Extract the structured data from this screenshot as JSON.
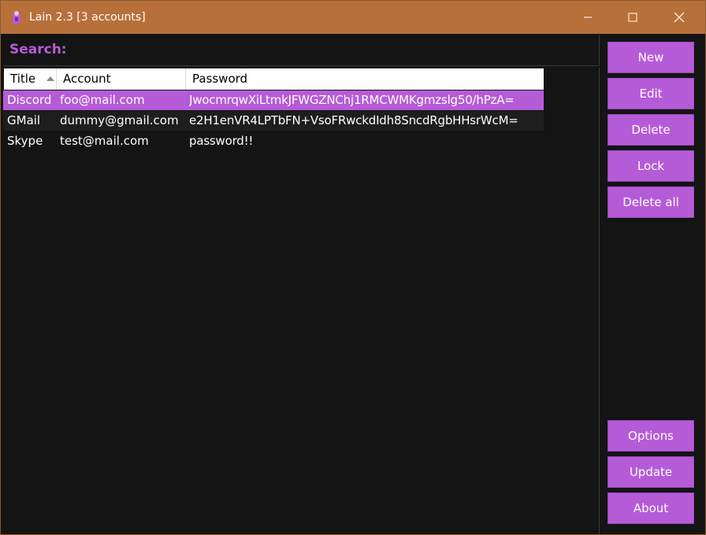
{
  "window": {
    "title": "Lain 2.3 [3 accounts]",
    "icon": "lain-app-icon"
  },
  "colors": {
    "accent": "#b65bd8",
    "titlebar": "#b8703a",
    "background": "#141414"
  },
  "search": {
    "label": "Search:",
    "value": ""
  },
  "table": {
    "columns": [
      "Title",
      "Account",
      "Password"
    ],
    "sorted_column": "Title",
    "sort_direction": "ascending",
    "rows": [
      {
        "title": "Discord",
        "account": "foo@mail.com",
        "password": "JwocmrqwXiLtmkJFWGZNChj1RMCWMKgmzslg50/hPzA=",
        "selected": true
      },
      {
        "title": "GMail",
        "account": "dummy@gmail.com",
        "password": "e2H1enVR4LPTbFN+VsoFRwckdIdh8SncdRgbHHsrWcM=",
        "selected": false
      },
      {
        "title": "Skype",
        "account": "test@mail.com",
        "password": "password!!",
        "selected": false
      }
    ]
  },
  "buttons_top": [
    {
      "label": "New"
    },
    {
      "label": "Edit"
    },
    {
      "label": "Delete"
    },
    {
      "label": "Lock"
    },
    {
      "label": "Delete all"
    }
  ],
  "buttons_bottom": [
    {
      "label": "Options"
    },
    {
      "label": "Update"
    },
    {
      "label": "About"
    }
  ]
}
